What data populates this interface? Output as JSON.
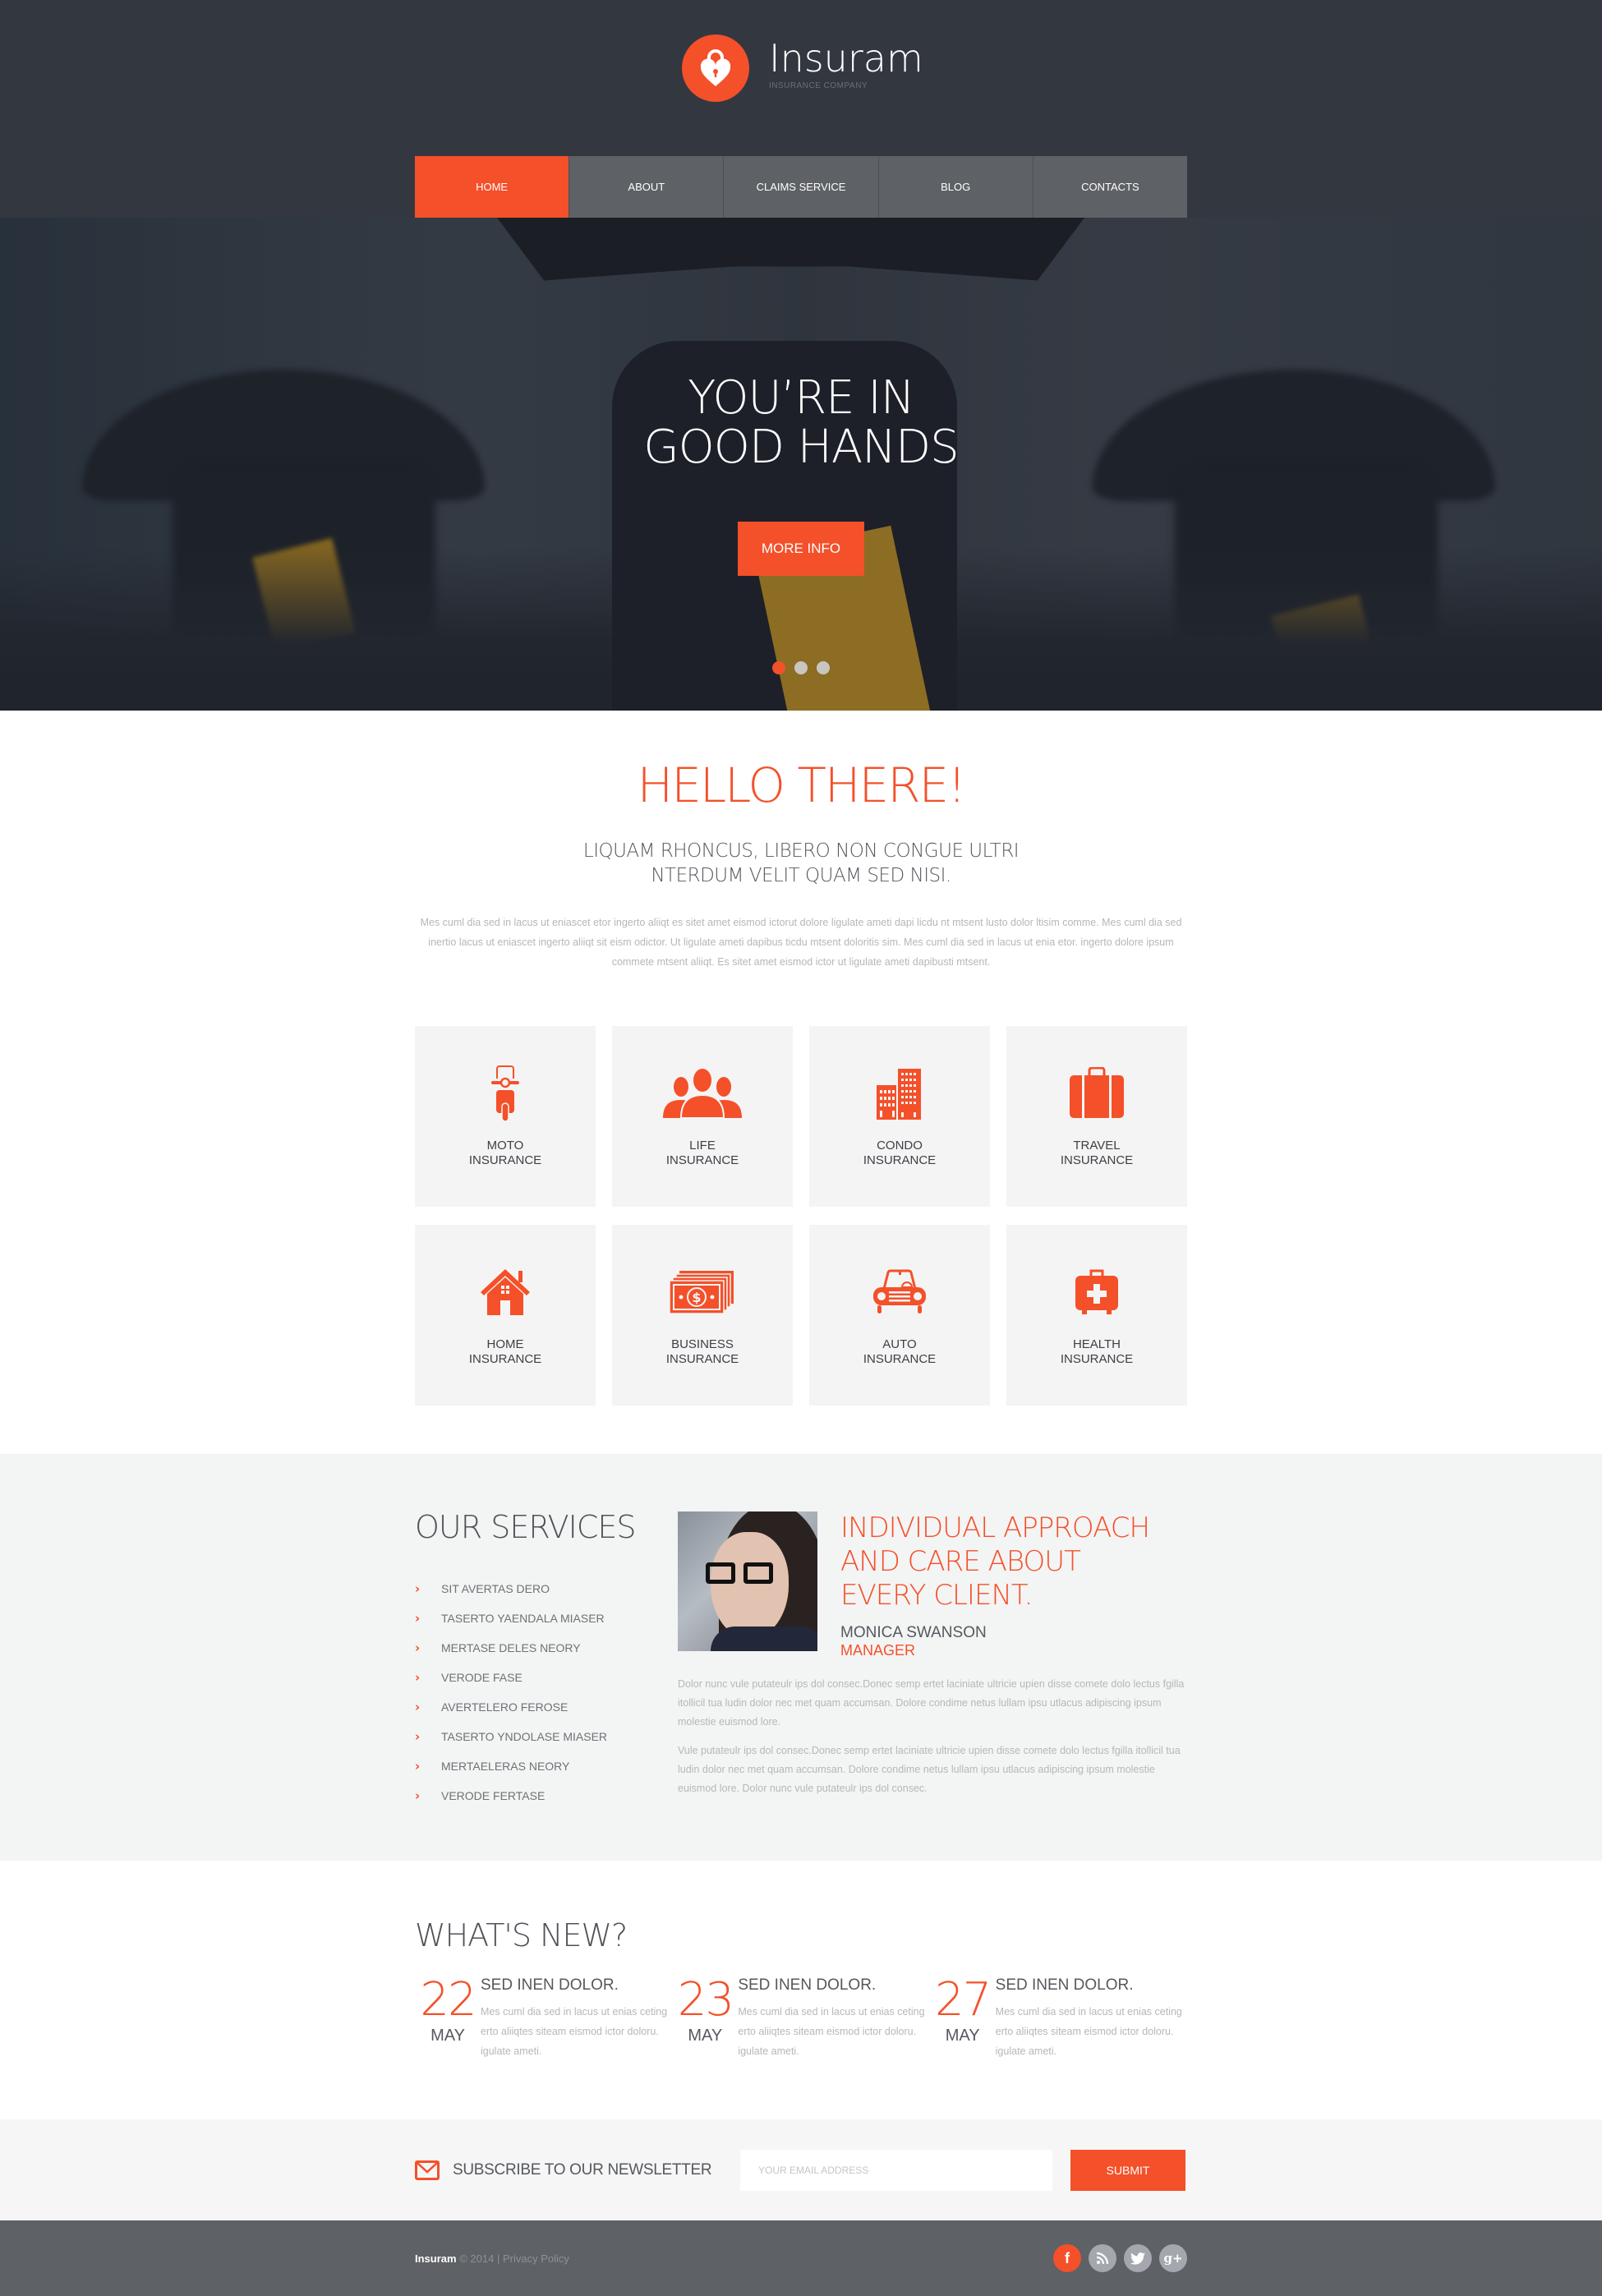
{
  "brand": {
    "name": "Insuram",
    "tagline": "INSURANCE COMPANY",
    "accent_color": "#f4502a",
    "logo_icon": "heart-lock-icon"
  },
  "nav": {
    "items": [
      {
        "label": "HOME",
        "active": true
      },
      {
        "label": "ABOUT",
        "active": false
      },
      {
        "label": "CLAIMS SERVICE",
        "active": false
      },
      {
        "label": "BLOG",
        "active": false
      },
      {
        "label": "CONTACTS",
        "active": false
      }
    ]
  },
  "hero": {
    "title_line1": "YOU’RE IN",
    "title_line2": "GOOD HANDS",
    "button_label": "MORE INFO",
    "slides_count": 3,
    "active_slide": 1
  },
  "hello": {
    "title": "HELLO THERE!",
    "subtitle_line1": "LIQUAM RHONCUS, LIBERO NON CONGUE ULTRI",
    "subtitle_line2": "NTERDUM VELIT QUAM SED NISI.",
    "body": "Mes cuml dia sed in lacus ut eniascet etor ingerto aliiqt es sitet amet eismod ictorut dolore ligulate ameti dapi licdu nt mtsent lusto dolor ltisim comme. Mes cuml dia sed inertio lacus ut eniascet ingerto aliiqt sit eism odictor. Ut ligulate ameti dapibus ticdu mtsent doloritis sim. Mes cuml dia sed in lacus ut enia etor. ingerto dolore ipsum commete mtsent aliiqt. Es sitet amet eismod ictor ut ligulate ameti dapibusti mtsent."
  },
  "insurance_tiles": [
    {
      "line1": "MOTO",
      "line2": "INSURANCE",
      "icon": "scooter-icon"
    },
    {
      "line1": "LIFE",
      "line2": "INSURANCE",
      "icon": "people-group-icon"
    },
    {
      "line1": "CONDO",
      "line2": "INSURANCE",
      "icon": "buildings-icon"
    },
    {
      "line1": "TRAVEL",
      "line2": "INSURANCE",
      "icon": "suitcase-icon"
    },
    {
      "line1": "HOME",
      "line2": "INSURANCE",
      "icon": "house-icon"
    },
    {
      "line1": "BUSINESS",
      "line2": "INSURANCE",
      "icon": "money-stack-icon"
    },
    {
      "line1": "AUTO",
      "line2": "INSURANCE",
      "icon": "car-icon"
    },
    {
      "line1": "HEALTH",
      "line2": "INSURANCE",
      "icon": "medical-kit-icon"
    }
  ],
  "services": {
    "title": "OUR SERVICES",
    "items": [
      "SIT AVERTAS DERO",
      "TASERTO YAENDALA MIASER",
      "MERTASE DELES NEORY",
      "VERODE FASE",
      "AVERTELERO FEROSE",
      "TASERTO YNDOLASE MIASER",
      "MERTAELERAS NEORY",
      "VERODE FERTASE"
    ],
    "quote_line1": "INDIVIDUAL APPROACH",
    "quote_line2": "AND CARE ABOUT",
    "quote_line3": "EVERY CLIENT.",
    "person_name": "MONICA SWANSON",
    "person_role": "MANAGER",
    "paragraph1": "Dolor nunc vule putateulr ips dol consec.Donec semp ertet laciniate ultricie upien disse comete dolo lectus fgilla itollicil tua ludin dolor nec met quam accumsan. Dolore condime netus lullam ipsu utlacus adipiscing ipsum molestie euismod lore.",
    "paragraph2": "Vule putateulr ips dol consec.Donec semp ertet laciniate ultricie upien disse comete dolo lectus fgilla itollicil tua ludin dolor nec met quam accumsan. Dolore condime netus lullam ipsu utlacus adipiscing ipsum molestie euismod lore. Dolor nunc vule putateulr ips dol consec."
  },
  "news": {
    "title": "WHAT'S NEW?",
    "items": [
      {
        "day": "22",
        "month": "MAY",
        "title": "SED INEN DOLOR.",
        "text": "Mes cuml dia sed in lacus ut enias ceting erto aliiqtes siteam eismod ictor doloru. igulate ameti."
      },
      {
        "day": "23",
        "month": "MAY",
        "title": "SED INEN DOLOR.",
        "text": "Mes cuml dia sed in lacus ut enias ceting erto aliiqtes siteam eismod ictor doloru. igulate ameti."
      },
      {
        "day": "27",
        "month": "MAY",
        "title": "SED INEN DOLOR.",
        "text": "Mes cuml dia sed in lacus ut enias ceting erto aliiqtes siteam eismod ictor doloru. igulate ameti."
      }
    ]
  },
  "newsletter": {
    "label": "SUBSCRIBE TO OUR NEWSLETTER",
    "placeholder": "YOUR EMAIL ADDRESS",
    "value": "",
    "submit_label": "SUBMIT"
  },
  "footer": {
    "brand": "Insuram",
    "copyright": "© 2014",
    "separator": "|",
    "privacy_label": "Privacy Policy",
    "social": [
      {
        "name": "facebook",
        "glyph": "f"
      },
      {
        "name": "rss",
        "glyph": ""
      },
      {
        "name": "twitter",
        "glyph": ""
      },
      {
        "name": "google-plus",
        "glyph": "g+"
      }
    ]
  }
}
